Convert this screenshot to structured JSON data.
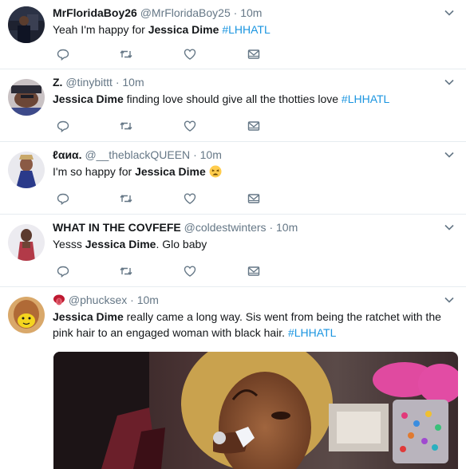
{
  "tweets": [
    {
      "name": "MrFloridaBoy26",
      "handle": "@MrFloridaBoy25",
      "dot": "·",
      "time": "10m",
      "text_parts": [
        "Yeah I'm happy for ",
        "Jessica Dime",
        " ",
        "#LHHATL"
      ]
    },
    {
      "name": "Z.",
      "handle": "@tinybittt",
      "dot": "·",
      "time": "10m",
      "text_parts": [
        "Jessica Dime",
        " finding love should give all the thotties love ",
        "#LHHATL"
      ]
    },
    {
      "name": "ℓαиα.",
      "handle": "@__theblackQUEEN",
      "dot": "·",
      "time": "10m",
      "text_parts": [
        "I'm so happy for ",
        "Jessica Dime",
        " "
      ],
      "emoji": "tired-face-emoji"
    },
    {
      "name": "WHAT IN THE COVFEFE",
      "handle": "@coldestwinters",
      "dot": "·",
      "time": "10m",
      "text_parts": [
        "Yesss ",
        "Jessica Dime",
        ". Glo baby"
      ]
    },
    {
      "name_emoji": "tongue-emoji",
      "handle": "@phucksex",
      "dot": "·",
      "time": "10m",
      "text_parts": [
        "Jessica Dime",
        " really came a long way. Sis went from being the ratchet with the pink hair to an engaged woman with black hair. ",
        "#LHHATL"
      ],
      "media": "photo-woman-wiping-tear"
    }
  ],
  "icons": {
    "reply": "reply-icon",
    "retweet": "retweet-icon",
    "like": "heart-icon",
    "dm": "envelope-icon",
    "menu": "chevron-down-icon"
  },
  "colors": {
    "hashtag": "#1b95e0",
    "muted": "#657786",
    "icon": "#657786",
    "divider": "#e6ecf0"
  }
}
